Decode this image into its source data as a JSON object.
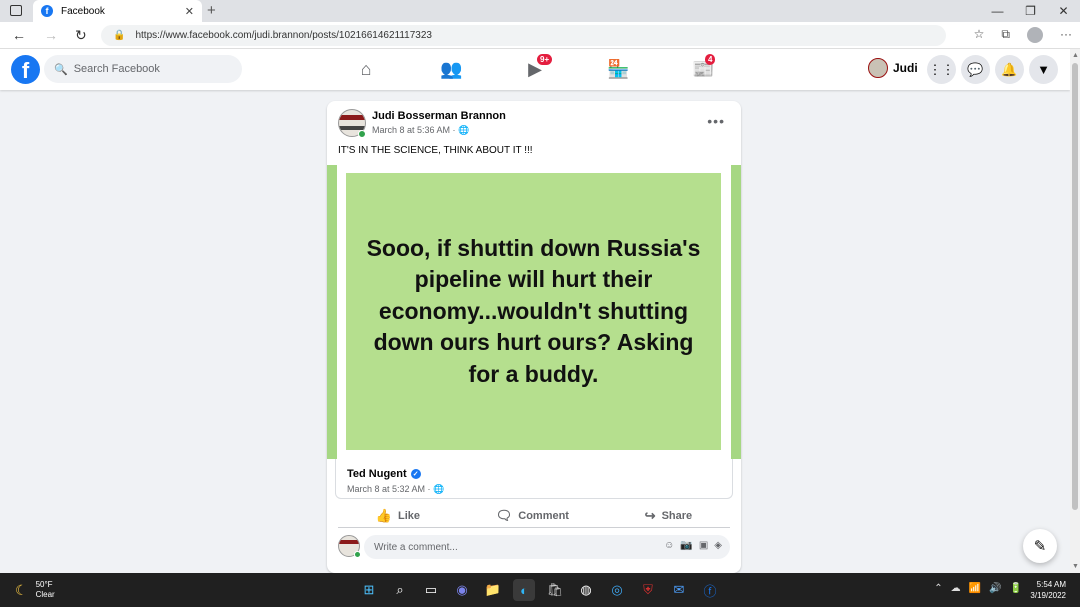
{
  "browser": {
    "tab_title": "Facebook",
    "tab_close": "✕",
    "new_tab": "+",
    "url": "https://www.facebook.com/judi.brannon/posts/10216614621117323",
    "window_controls": [
      "—",
      "❐",
      "✕"
    ]
  },
  "fb": {
    "search_placeholder": "Search Facebook",
    "watch_badge": "9+",
    "notif_badge": "4",
    "user_name": "Judi"
  },
  "post": {
    "author": "Judi Bosserman Brannon",
    "meta": "March 8 at 5:36 AM · 🌐",
    "caption": "IT'S IN THE SCIENCE, THINK ABOUT IT !!!",
    "image_text": "Sooo, if shuttin down Russia's pipeline will hurt their economy...wouldn't shutting down ours hurt ours? Asking for a buddy.",
    "shared_from": "Ted Nugent",
    "shared_meta": "March 8 at 5:32 AM · 🌐",
    "actions": {
      "like": "Like",
      "comment": "Comment",
      "share": "Share"
    },
    "comment_placeholder": "Write a comment..."
  },
  "taskbar": {
    "temperature": "50°F",
    "condition": "Clear",
    "time": "5:54 AM",
    "date": "3/19/2022"
  },
  "colors": {
    "fb_blue": "#1877f2",
    "image_bg": "#b5df8e",
    "badge_red": "#e41e3f"
  }
}
